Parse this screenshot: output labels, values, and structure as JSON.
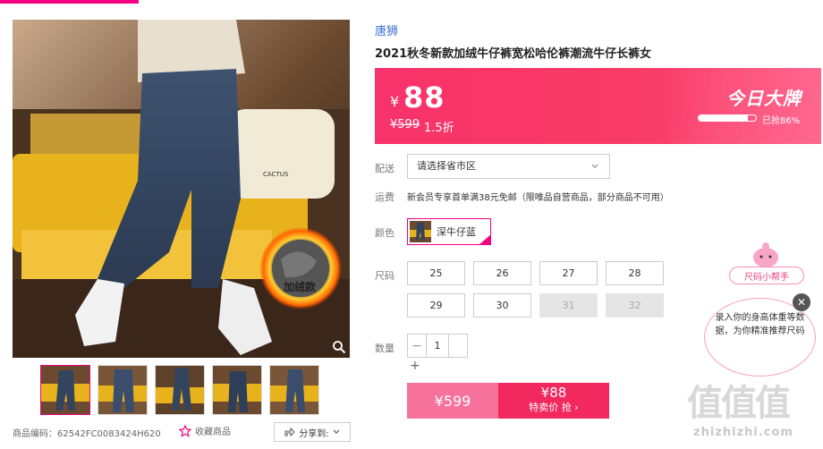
{
  "product": {
    "brand": "唐狮",
    "title": "2021秋冬新款加绒牛仔裤宽松哈伦裤潮流牛仔长裤女",
    "photo_tag": "加绒款",
    "sku_label": "商品编码：62542FC0083424H620",
    "favorite_label": "收藏商品",
    "share_label": "分享到:"
  },
  "price": {
    "currency": "¥",
    "sale": "88",
    "original": "¥599",
    "discount": "1.5折",
    "badge": "今日大牌",
    "sold_percent": 86,
    "sold_text": "已抢86%"
  },
  "delivery": {
    "label": "配送",
    "placeholder": "请选择省市区"
  },
  "shipping": {
    "label": "运费",
    "text": "新会员专享首单满38元免邮（限唯品自营商品，部分商品不可用）"
  },
  "color": {
    "label": "颜色",
    "selected": "深牛仔蓝"
  },
  "size": {
    "label": "尺码",
    "options": [
      "25",
      "26",
      "27",
      "28",
      "29",
      "30",
      "31",
      "32"
    ],
    "disabled": [
      "31",
      "32"
    ]
  },
  "quantity": {
    "label": "数量",
    "value": "1",
    "minus": "−",
    "plus": "+"
  },
  "buy": {
    "original_price": "¥599",
    "sale_price": "¥88",
    "sale_text": "特卖价 抢 ›"
  },
  "helper": {
    "pill": "尺码小帮手",
    "bubble": "录入你的身高体重等数据，为你精准推荐尺码",
    "close": "✕"
  },
  "watermark": {
    "logo": "值值值",
    "url": "zhizhizhi.com"
  },
  "colors": {
    "accent": "#f10180",
    "price_bg": "#f8326a",
    "link": "#3a6fd8"
  }
}
